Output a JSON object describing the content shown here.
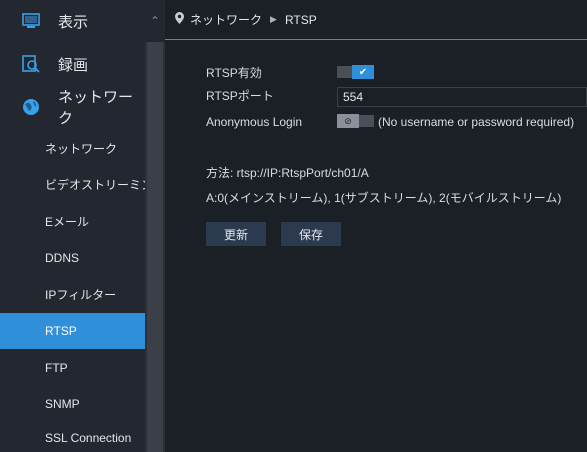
{
  "sidebar": {
    "main_items": [
      {
        "label": "表示",
        "icon": "monitor-icon"
      },
      {
        "label": "録画",
        "icon": "record-search-icon"
      },
      {
        "label": "ネットワーク",
        "icon": "globe-icon"
      }
    ],
    "sub_items": [
      {
        "label": "ネットワーク"
      },
      {
        "label": "ビデオストリーミング"
      },
      {
        "label": "Eメール"
      },
      {
        "label": "DDNS"
      },
      {
        "label": "IPフィルター"
      },
      {
        "label": "RTSP"
      },
      {
        "label": "FTP"
      },
      {
        "label": "SNMP"
      },
      {
        "label": "SSL Connection"
      }
    ],
    "active_sub": "RTSP"
  },
  "breadcrumb": {
    "items": [
      "ネットワーク",
      "RTSP"
    ]
  },
  "form": {
    "rtsp_enable_label": "RTSP有効",
    "rtsp_enable_value": true,
    "rtsp_port_label": "RTSPポート",
    "rtsp_port_value": "554",
    "anon_login_label": "Anonymous Login",
    "anon_login_value": false,
    "anon_login_hint": "(No username or password required)",
    "method_text": "方法: rtsp://IP:RtspPort/ch01/A",
    "stream_text": "A:0(メインストリーム), 1(サブストリーム), 2(モバイルストリーム)"
  },
  "buttons": {
    "refresh_label": "更新",
    "save_label": "保存"
  },
  "colors": {
    "accent": "#2f8fd8",
    "background": "#1b1f26",
    "sidebar": "#23272f"
  }
}
